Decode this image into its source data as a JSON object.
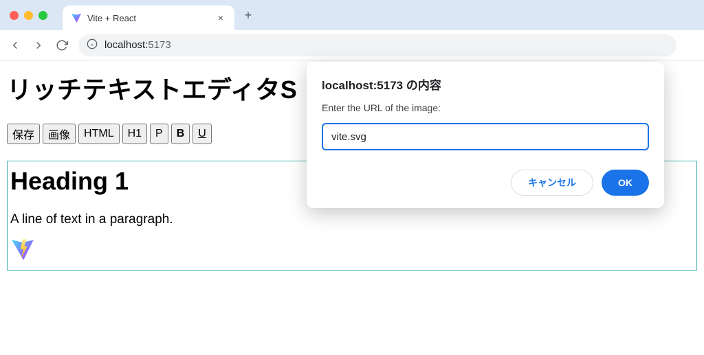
{
  "browser": {
    "tab_title": "Vite + React",
    "address_host": "localhost:",
    "address_port": "5173"
  },
  "page": {
    "title": "リッチテキストエディタS",
    "toolbar": {
      "save": "保存",
      "image": "画像",
      "html": "HTML",
      "h1": "H1",
      "p": "P",
      "b": "B",
      "u": "U"
    },
    "editor": {
      "heading": "Heading 1",
      "paragraph": "A line of text in a paragraph.",
      "image_alt": "vite-logo"
    }
  },
  "dialog": {
    "title": "localhost:5173 の内容",
    "message": "Enter the URL of the image:",
    "input_value": "vite.svg",
    "cancel": "キャンセル",
    "ok": "OK"
  }
}
